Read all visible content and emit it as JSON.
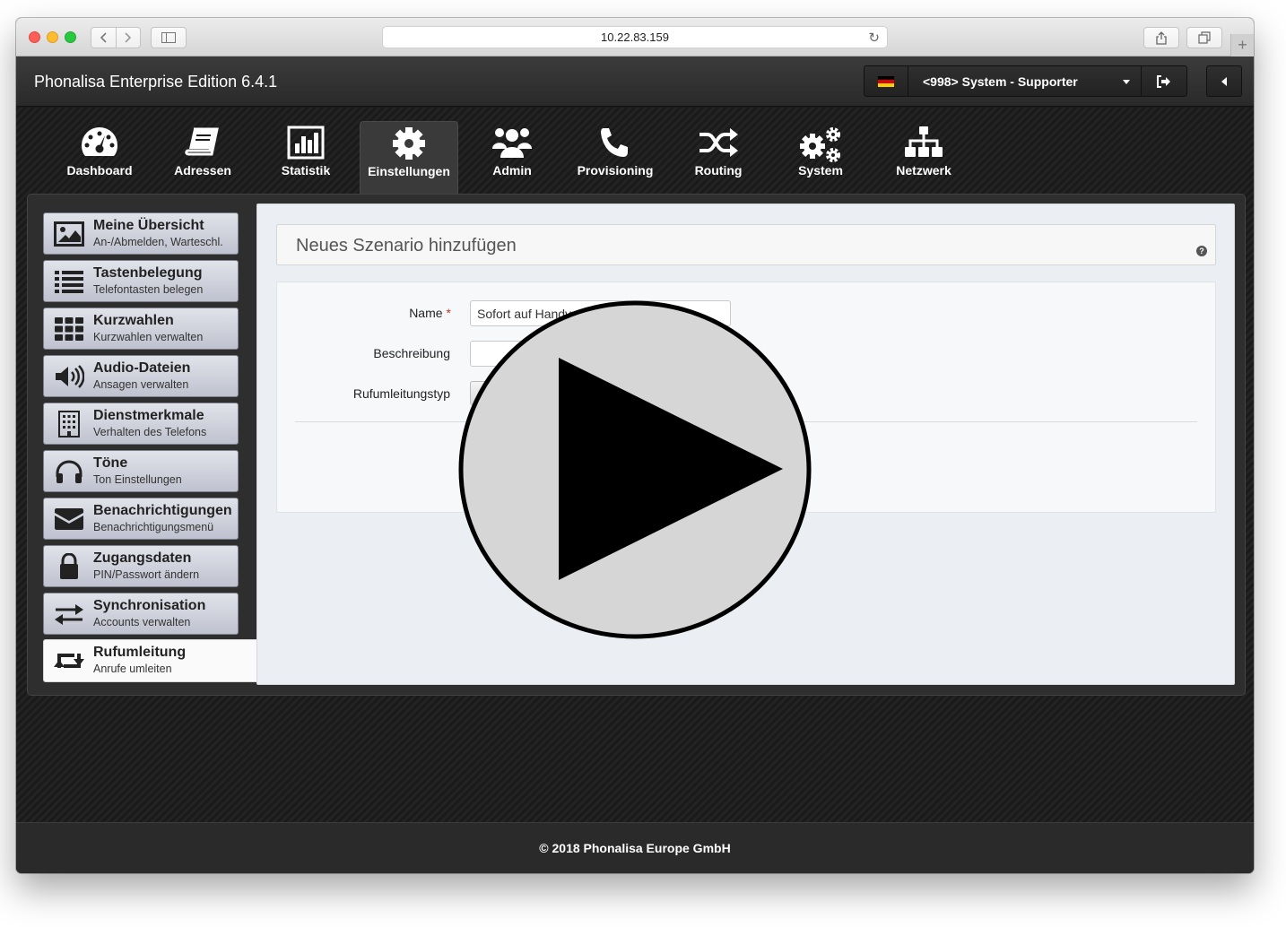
{
  "browser": {
    "url": "10.22.83.159"
  },
  "app": {
    "title": "Phonalisa Enterprise Edition 6.4.1",
    "user_label": "<998> System - Supporter"
  },
  "nav": {
    "items": [
      {
        "label": "Dashboard",
        "icon": "dashboard-icon"
      },
      {
        "label": "Adressen",
        "icon": "book-icon"
      },
      {
        "label": "Statistik",
        "icon": "bar-chart-icon"
      },
      {
        "label": "Einstellungen",
        "icon": "gear-icon",
        "active": true
      },
      {
        "label": "Admin",
        "icon": "users-icon"
      },
      {
        "label": "Provisioning",
        "icon": "phone-icon"
      },
      {
        "label": "Routing",
        "icon": "shuffle-icon"
      },
      {
        "label": "System",
        "icon": "gears-icon"
      },
      {
        "label": "Netzwerk",
        "icon": "sitemap-icon"
      }
    ]
  },
  "sidebar": {
    "items": [
      {
        "title": "Meine Übersicht",
        "subtitle": "An-/Abmelden, Warteschl.",
        "icon": "picture-icon"
      },
      {
        "title": "Tastenbelegung",
        "subtitle": "Telefontasten belegen",
        "icon": "list-icon"
      },
      {
        "title": "Kurzwahlen",
        "subtitle": "Kurzwahlen verwalten",
        "icon": "grid-icon"
      },
      {
        "title": "Audio-Dateien",
        "subtitle": "Ansagen verwalten",
        "icon": "volume-icon"
      },
      {
        "title": "Dienstmerkmale",
        "subtitle": "Verhalten des Telefons",
        "icon": "building-icon"
      },
      {
        "title": "Töne",
        "subtitle": "Ton Einstellungen",
        "icon": "headphones-icon"
      },
      {
        "title": "Benachrichtigungen",
        "subtitle": "Benachrichtigungsmenü",
        "icon": "envelope-icon"
      },
      {
        "title": "Zugangsdaten",
        "subtitle": "PIN/Passwort ändern",
        "icon": "lock-icon"
      },
      {
        "title": "Synchronisation",
        "subtitle": "Accounts verwalten",
        "icon": "exchange-icon"
      },
      {
        "title": "Rufumleitung",
        "subtitle": "Anrufe umleiten",
        "icon": "retweet-icon",
        "active": true
      }
    ]
  },
  "form": {
    "title": "Neues Szenario hinzufügen",
    "help": "?",
    "name_label": "Name",
    "required_mark": "*",
    "name_value": "Sofort auf Handy",
    "description_label": "Beschreibung",
    "description_value": "",
    "type_label": "Rufumleitungstyp"
  },
  "footer": {
    "text": "© 2018 Phonalisa Europe GmbH"
  },
  "colors": {
    "flag_black": "#000000",
    "flag_red": "#dd0000",
    "flag_gold": "#ffce00"
  }
}
